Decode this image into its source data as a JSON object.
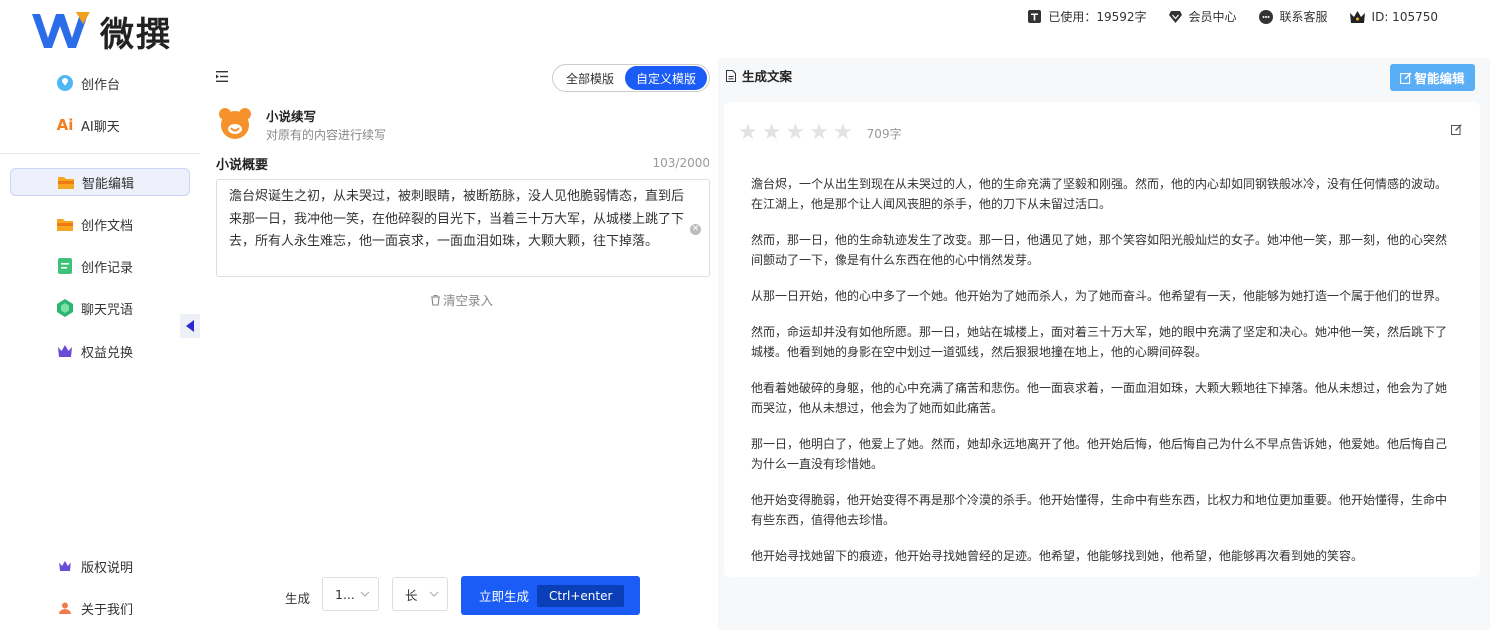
{
  "app": {
    "brand": "微撰"
  },
  "topbar": {
    "usage": "已使用：19592字",
    "member": "会员中心",
    "support": "联系客服",
    "user_id": "ID: 105750"
  },
  "sidebar": {
    "items": [
      {
        "label": "创作台",
        "icon": "bulb-icon"
      },
      {
        "label": "AI聊天",
        "icon": "ai-icon"
      },
      {
        "label": "智能编辑",
        "icon": "folder-icon",
        "active": true
      },
      {
        "label": "创作文档",
        "icon": "folder-icon"
      },
      {
        "label": "创作记录",
        "icon": "doc-icon"
      },
      {
        "label": "聊天咒语",
        "icon": "gem-icon"
      },
      {
        "label": "权益兑换",
        "icon": "crown-icon"
      }
    ],
    "bottom": [
      {
        "label": "版权说明",
        "icon": "crown-icon"
      },
      {
        "label": "关于我们",
        "icon": "user-icon"
      }
    ]
  },
  "mid": {
    "tabs": {
      "all": "全部模版",
      "custom": "自定义模版"
    },
    "template": {
      "title": "小说续写",
      "desc": "对原有的内容进行续写"
    },
    "field": {
      "label": "小说概要",
      "count": "103/2000",
      "value": "澹台烬诞生之初，从未哭过，被刺眼睛，被断筋脉，没人见他脆弱情态，直到后来那一日，我冲他一笑，在他碎裂的目光下，当着三十万大军，从城楼上跳了下去，所有人永生难忘，他一面哀求，一面血泪如珠，大颗大颗，往下掉落。"
    },
    "clear_label": "清空录入",
    "generate": {
      "label": "生成",
      "count_value": "1...",
      "length_value": "长",
      "button": "立即生成",
      "shortcut": "Ctrl+enter"
    }
  },
  "right": {
    "title": "生成文案",
    "smart_edit": "智能编辑",
    "rating": 0,
    "word_count": "709字",
    "paragraphs": [
      "澹台烬，一个从出生到现在从未哭过的人，他的生命充满了坚毅和刚强。然而，他的内心却如同钢铁般冰冷，没有任何情感的波动。在江湖上，他是那个让人闻风丧胆的杀手，他的刀下从未留过活口。",
      "然而，那一日，他的生命轨迹发生了改变。那一日，他遇见了她，那个笑容如阳光般灿烂的女子。她冲他一笑，那一刻，他的心突然间颤动了一下，像是有什么东西在他的心中悄然发芽。",
      "从那一日开始，他的心中多了一个她。他开始为了她而杀人，为了她而奋斗。他希望有一天，他能够为她打造一个属于他们的世界。",
      "然而，命运却并没有如他所愿。那一日，她站在城楼上，面对着三十万大军，她的眼中充满了坚定和决心。她冲他一笑，然后跳下了城楼。他看到她的身影在空中划过一道弧线，然后狠狠地撞在地上，他的心瞬间碎裂。",
      "他看着她破碎的身躯，他的心中充满了痛苦和悲伤。他一面哀求着，一面血泪如珠，大颗大颗地往下掉落。他从未想过，他会为了她而哭泣，他从未想过，他会为了她而如此痛苦。",
      "那一日，他明白了，他爱上了她。然而，她却永远地离开了他。他开始后悔，他后悔自己为什么不早点告诉她，他爱她。他后悔自己为什么一直没有珍惜她。",
      "他开始变得脆弱，他开始变得不再是那个冷漠的杀手。他开始懂得，生命中有些东西，比权力和地位更加重要。他开始懂得，生命中有些东西，值得他去珍惜。",
      "他开始寻找她留下的痕迹，他开始寻找她曾经的足迹。他希望，他能够找到她，他希望，他能够再次看到她的笑容。"
    ]
  },
  "colors": {
    "accent": "#1a5cf5",
    "smart_edit": "#5aaef5"
  }
}
